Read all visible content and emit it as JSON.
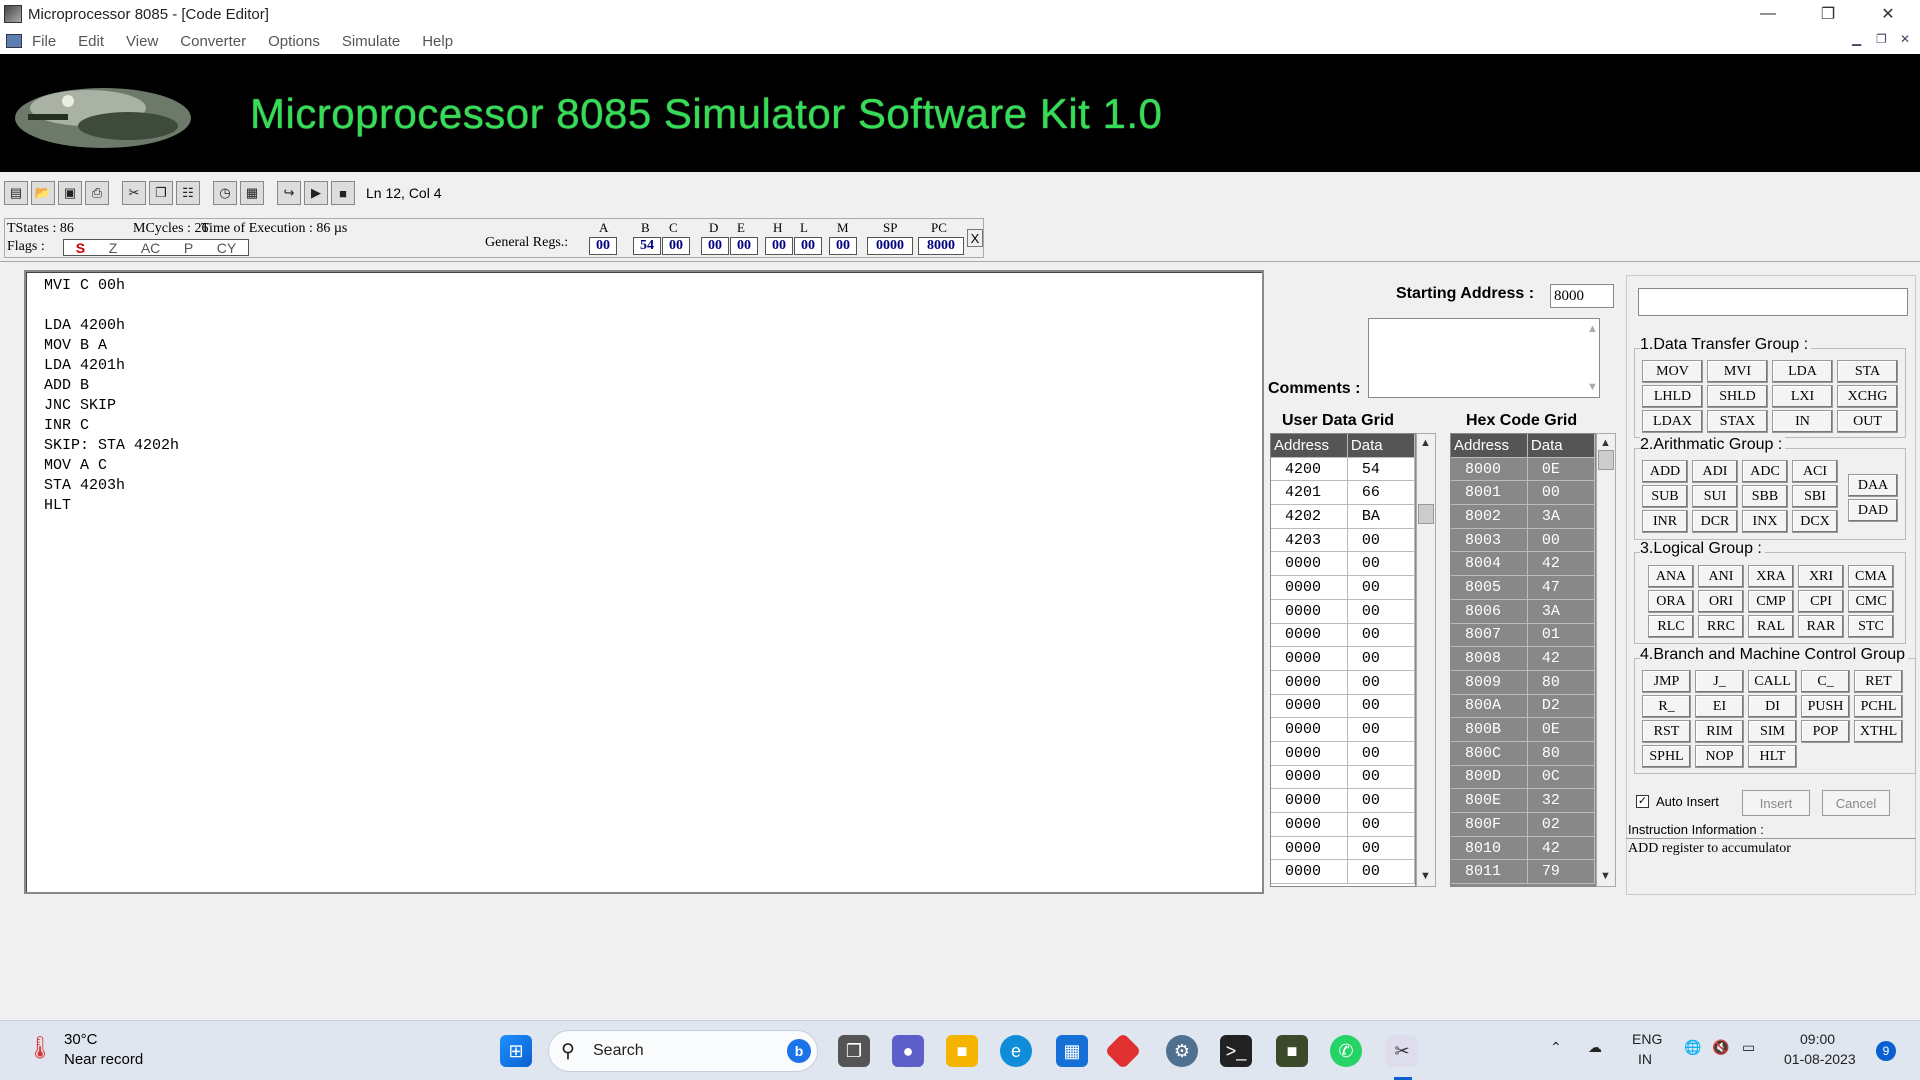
{
  "window": {
    "title": "Microprocessor 8085 - [Code Editor]"
  },
  "menu": {
    "items": [
      "File",
      "Edit",
      "View",
      "Converter",
      "Options",
      "Simulate",
      "Help"
    ]
  },
  "banner": {
    "title": "Microprocessor 8085 Simulator Software Kit 1.0"
  },
  "toolbar": {
    "cursor_position": "Ln 12, Col 4",
    "icons": [
      "new-icon",
      "open-icon",
      "save-icon",
      "print-icon",
      "cut-icon",
      "copy-icon",
      "paste-icon",
      "timer-icon",
      "memory-icon",
      "step-icon",
      "run-icon",
      "stop-icon"
    ]
  },
  "status": {
    "tstates": "TStates : 86",
    "mcycles": "MCycles : 26",
    "exec_time": "Time of Execution : 86 µs",
    "flags_label": "Flags :",
    "flags": [
      "S",
      "Z",
      "AC",
      "P",
      "CY"
    ],
    "active_flag_color": "#d00000",
    "general_regs_label": "General Regs.:",
    "close": "X"
  },
  "registers": {
    "A": {
      "label": "A",
      "value": "00"
    },
    "B": {
      "label": "B",
      "value": "54"
    },
    "C": {
      "label": "C",
      "value": "00"
    },
    "D": {
      "label": "D",
      "value": "00"
    },
    "E": {
      "label": "E",
      "value": "00"
    },
    "H": {
      "label": "H",
      "value": "00"
    },
    "L": {
      "label": "L",
      "value": "00"
    },
    "M": {
      "label": "M",
      "value": "00"
    },
    "SP": {
      "label": "SP",
      "value": "0000"
    },
    "PC": {
      "label": "PC",
      "value": "8000"
    }
  },
  "editor": {
    "code": "MVI C 00h\n\nLDA 4200h\nMOV B A\nLDA 4201h\nADD B\nJNC SKIP\nINR C\nSKIP: STA 4202h\nMOV A C\nSTA 4203h\nHLT"
  },
  "starting_address": {
    "label": "Starting Address :",
    "value": "8000"
  },
  "comments": {
    "label": "Comments :"
  },
  "user_grid": {
    "title": "User Data Grid",
    "headers": [
      "Address",
      "Data"
    ],
    "rows": [
      [
        "4200",
        "54"
      ],
      [
        "4201",
        "66"
      ],
      [
        "4202",
        "BA"
      ],
      [
        "4203",
        "00"
      ],
      [
        "0000",
        "00"
      ],
      [
        "0000",
        "00"
      ],
      [
        "0000",
        "00"
      ],
      [
        "0000",
        "00"
      ],
      [
        "0000",
        "00"
      ],
      [
        "0000",
        "00"
      ],
      [
        "0000",
        "00"
      ],
      [
        "0000",
        "00"
      ],
      [
        "0000",
        "00"
      ],
      [
        "0000",
        "00"
      ],
      [
        "0000",
        "00"
      ],
      [
        "0000",
        "00"
      ],
      [
        "0000",
        "00"
      ],
      [
        "0000",
        "00"
      ]
    ]
  },
  "hex_grid": {
    "title": "Hex Code Grid",
    "headers": [
      "Address",
      "Data"
    ],
    "rows": [
      [
        "8000",
        "0E"
      ],
      [
        "8001",
        "00"
      ],
      [
        "8002",
        "3A"
      ],
      [
        "8003",
        "00"
      ],
      [
        "8004",
        "42"
      ],
      [
        "8005",
        "47"
      ],
      [
        "8006",
        "3A"
      ],
      [
        "8007",
        "01"
      ],
      [
        "8008",
        "42"
      ],
      [
        "8009",
        "80"
      ],
      [
        "800A",
        "D2"
      ],
      [
        "800B",
        "0E"
      ],
      [
        "800C",
        "80"
      ],
      [
        "800D",
        "0C"
      ],
      [
        "800E",
        "32"
      ],
      [
        "800F",
        "02"
      ],
      [
        "8010",
        "42"
      ],
      [
        "8011",
        "79"
      ]
    ]
  },
  "instructions": {
    "data_transfer": {
      "title": "1.Data Transfer Group :",
      "buttons": [
        "MOV",
        "MVI",
        "LDA",
        "STA",
        "LHLD",
        "SHLD",
        "LXI",
        "XCHG",
        "LDAX",
        "STAX",
        "IN",
        "OUT"
      ]
    },
    "arithmetic": {
      "title": "2.Arithmatic Group :",
      "buttons": [
        "ADD",
        "ADI",
        "ADC",
        "ACI",
        "SUB",
        "SUI",
        "SBB",
        "SBI",
        "INR",
        "DCR",
        "INX",
        "DCX"
      ],
      "side": [
        "DAA",
        "DAD"
      ]
    },
    "logical": {
      "title": "3.Logical Group :",
      "buttons": [
        "ANA",
        "ANI",
        "XRA",
        "XRI",
        "CMA",
        "ORA",
        "ORI",
        "CMP",
        "CPI",
        "CMC",
        "RLC",
        "RRC",
        "RAL",
        "RAR",
        "STC"
      ]
    },
    "branch": {
      "title": "4.Branch and Machine Control Group",
      "buttons": [
        "JMP",
        "J_",
        "CALL",
        "C_",
        "RET",
        "R_",
        "EI",
        "DI",
        "PUSH",
        "PCHL",
        "RST",
        "RIM",
        "SIM",
        "POP",
        "XTHL",
        "SPHL",
        "NOP",
        "HLT"
      ]
    }
  },
  "controls": {
    "auto_insert": "Auto Insert",
    "insert": "Insert",
    "cancel": "Cancel"
  },
  "instruction_info": {
    "label": "Instruction Information :",
    "text": "ADD register to accumulator"
  },
  "taskbar": {
    "weather_temp": "30°C",
    "weather_desc": "Near record",
    "search": "Search",
    "lang1": "ENG",
    "lang2": "IN",
    "time": "09:00",
    "date": "01-08-2023",
    "notif": "9"
  }
}
